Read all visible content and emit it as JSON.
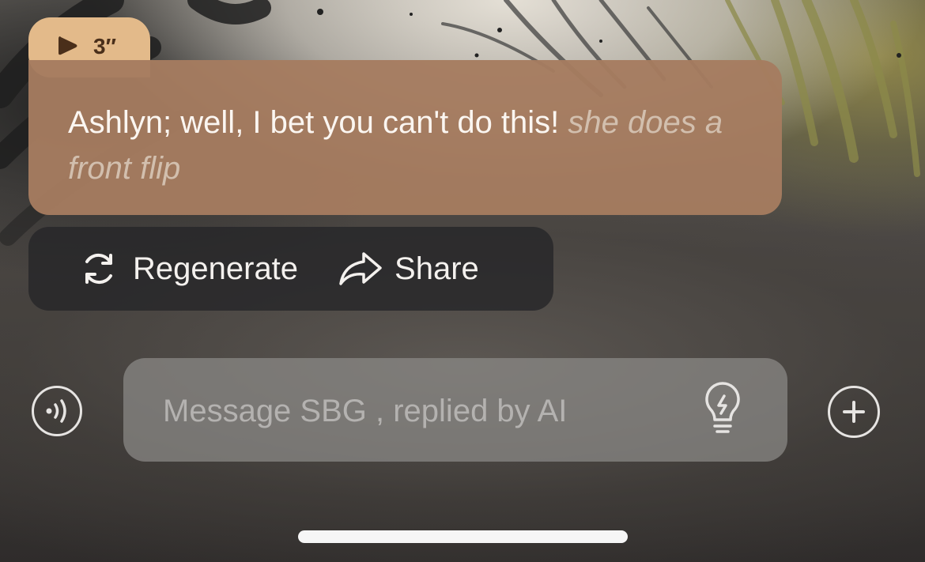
{
  "voice_badge": {
    "duration": "3″"
  },
  "message": {
    "speech": "Ashlyn; well, I bet you can't do this!",
    "action": "she does a front flip"
  },
  "actions": {
    "regenerate_label": "Regenerate",
    "share_label": "Share"
  },
  "composer": {
    "placeholder": "Message SBG , replied by AI",
    "value": ""
  },
  "icons": {
    "voice_badge": "play-icon",
    "regenerate": "refresh-icon",
    "share": "share-arrow-icon",
    "voice_input": "voice-wave-icon",
    "suggestion": "lightbulb-icon",
    "add": "plus-icon"
  },
  "colors": {
    "badge": "#e3ba8a",
    "bubble": "#a67c60",
    "action_text": "#d2bfae",
    "actions_bar": "#262528",
    "input_box": "#8c8a88"
  }
}
